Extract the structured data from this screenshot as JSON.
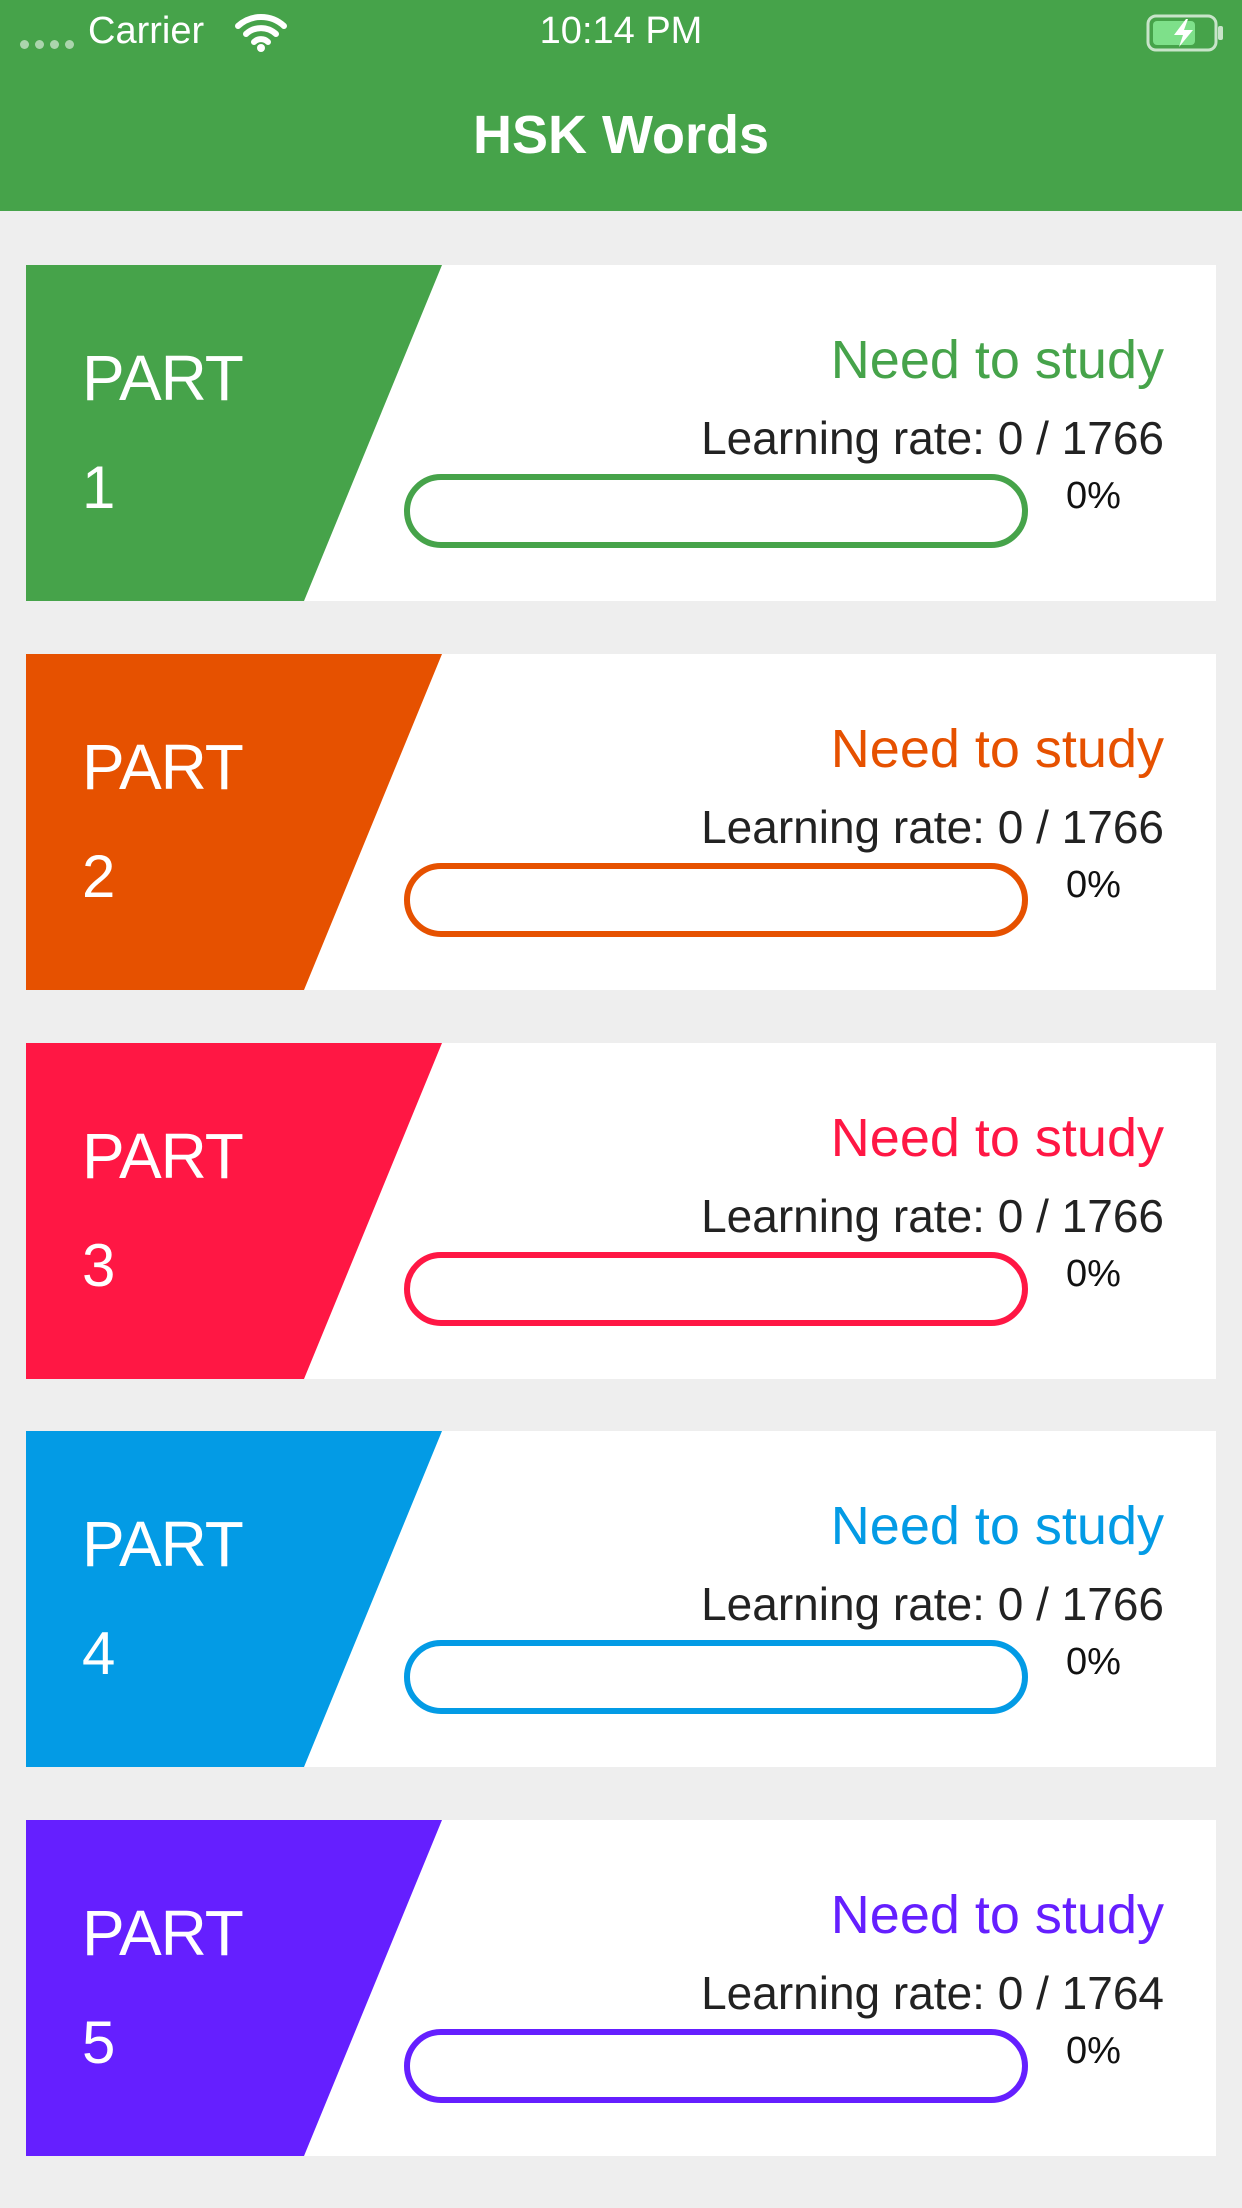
{
  "status_bar": {
    "carrier": "Carrier",
    "time": "10:14 PM",
    "wifi_icon": "wifi-icon",
    "battery_icon": "battery-charging-icon"
  },
  "nav": {
    "title": "HSK Words",
    "background": "#46a34a"
  },
  "parts": [
    {
      "label": "PART",
      "number": "1",
      "status": "Need to study",
      "rate": "Learning rate: 0 / 1766",
      "percent": "0%",
      "progress": 0,
      "color": "#46a34a"
    },
    {
      "label": "PART",
      "number": "2",
      "status": "Need to study",
      "rate": "Learning rate: 0 / 1766",
      "percent": "0%",
      "progress": 0,
      "color": "#e65100"
    },
    {
      "label": "PART",
      "number": "3",
      "status": "Need to study",
      "rate": "Learning rate: 0 / 1766",
      "percent": "0%",
      "progress": 0,
      "color": "#ff1744"
    },
    {
      "label": "PART",
      "number": "4",
      "status": "Need to study",
      "rate": "Learning rate: 0 / 1766",
      "percent": "0%",
      "progress": 0,
      "color": "#039be5"
    },
    {
      "label": "PART",
      "number": "5",
      "status": "Need to study",
      "rate": "Learning rate: 0 / 1764",
      "percent": "0%",
      "progress": 0,
      "color": "#651fff"
    }
  ]
}
